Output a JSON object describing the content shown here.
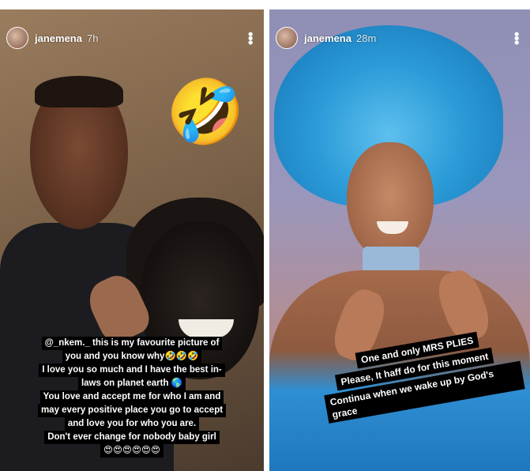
{
  "stories": [
    {
      "username": "janemena",
      "time": "7h",
      "sticker": "🤣",
      "caption_lines": [
        "@_nkem._ this is my favourite picture of",
        "you and you know why🤣🤣🤣",
        "I love you so much and I have the best in-",
        "laws on planet earth 🌎",
        "You love and accept me for who I am and",
        "may every positive place you go to accept",
        "and love you for who you are.",
        "Don't ever change for nobody baby girl",
        "😍😍😍😍😍😍"
      ]
    },
    {
      "username": "janemena",
      "time": "28m",
      "caption_lines": [
        "One and only MRS PLIES",
        "Please, It haff do for this moment",
        "Continua when we wake up by God's grace"
      ]
    }
  ],
  "icons": {
    "more": "more-options-icon"
  }
}
